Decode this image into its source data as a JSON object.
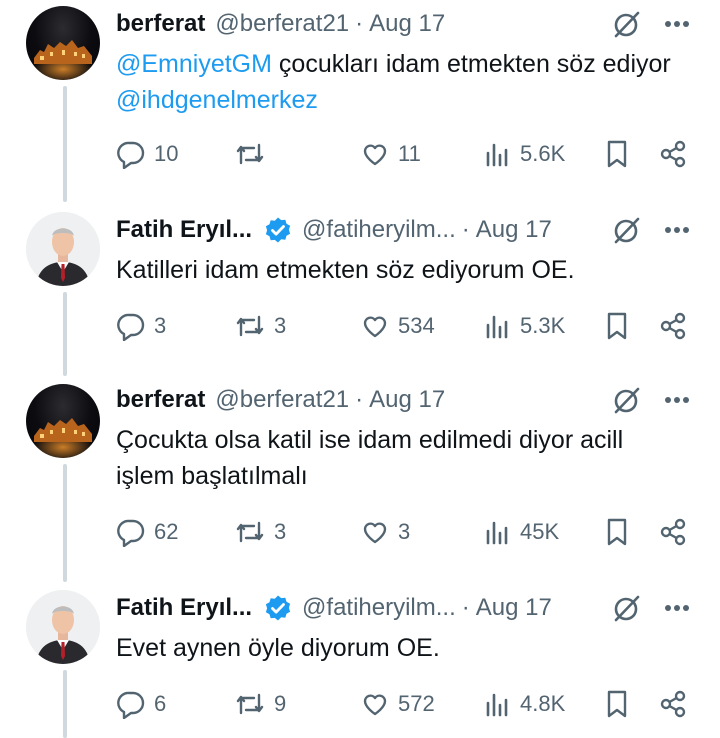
{
  "tweets": [
    {
      "name": "berferat",
      "handle": "@berferat21",
      "separator": "·",
      "date": "Aug 17",
      "verified": false,
      "avatar_icon": "night-city-avatar",
      "text_parts": [
        {
          "text": "@EmniyetGM",
          "mention": true
        },
        {
          "text": " çocukları idam etmekten söz ediyor ",
          "mention": false
        },
        {
          "text": "@ihdgenelmerkez",
          "mention": true
        }
      ],
      "replies": "10",
      "reposts": "",
      "likes": "11",
      "views": "5.6K"
    },
    {
      "name": "Fatih Eryıl...",
      "handle": "@fatiheryilm...",
      "separator": "·",
      "date": "Aug 17",
      "verified": true,
      "avatar_icon": "man-in-suit-avatar",
      "text_parts": [
        {
          "text": "Katilleri idam etmekten söz ediyorum OE.",
          "mention": false
        }
      ],
      "replies": "3",
      "reposts": "3",
      "likes": "534",
      "views": "5.3K"
    },
    {
      "name": "berferat",
      "handle": "@berferat21",
      "separator": "·",
      "date": "Aug 17",
      "verified": false,
      "avatar_icon": "night-city-avatar",
      "text_parts": [
        {
          "text": "Çocukta olsa katil ise idam edilmedi diyor acill işlem başlatılmalı",
          "mention": false
        }
      ],
      "replies": "62",
      "reposts": "3",
      "likes": "3",
      "views": "45K"
    },
    {
      "name": "Fatih Eryıl...",
      "handle": "@fatiheryilm...",
      "separator": "·",
      "date": "Aug 17",
      "verified": true,
      "avatar_icon": "man-in-suit-avatar",
      "text_parts": [
        {
          "text": "Evet aynen öyle diyorum OE.",
          "mention": false
        }
      ],
      "replies": "6",
      "reposts": "9",
      "likes": "572",
      "views": "4.8K"
    }
  ],
  "colors": {
    "text": "#0f1419",
    "secondary": "#536471",
    "accent": "#1d9bf0",
    "thread_line": "#cfd9de"
  }
}
